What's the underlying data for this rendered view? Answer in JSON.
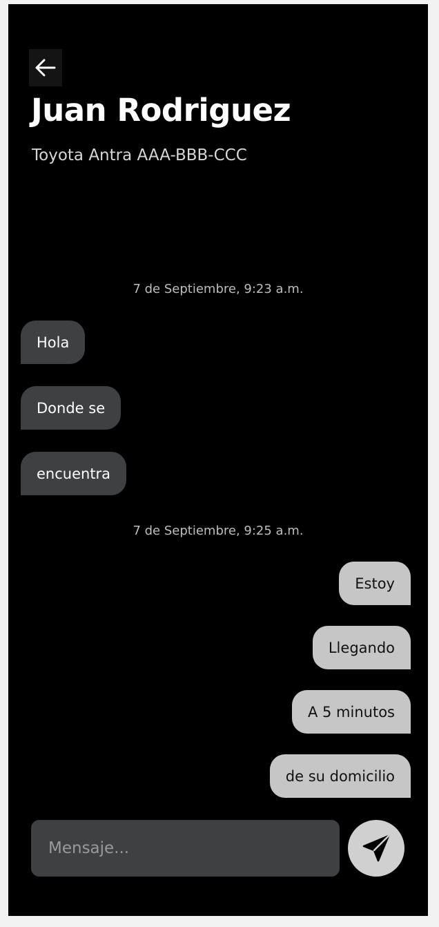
{
  "header": {
    "back_icon": "arrow-left-icon",
    "contact_name": "Juan Rodriguez",
    "vehicle": "Toyota Antra AAA-BBB-CCC"
  },
  "conversation": {
    "groups": [
      {
        "timestamp": "7 de Septiembre, 9:23 a.m.",
        "messages": [
          {
            "direction": "incoming",
            "text": "Hola"
          },
          {
            "direction": "incoming",
            "text": "Donde se"
          },
          {
            "direction": "incoming",
            "text": "encuentra"
          }
        ]
      },
      {
        "timestamp": "7 de Septiembre, 9:25 a.m.",
        "messages": [
          {
            "direction": "outgoing",
            "text": "Estoy"
          },
          {
            "direction": "outgoing",
            "text": "Llegando"
          },
          {
            "direction": "outgoing",
            "text": "A 5 minutos"
          },
          {
            "direction": "outgoing",
            "text": "de su domicilio"
          }
        ]
      }
    ]
  },
  "composer": {
    "placeholder": "Mensaje...",
    "value": "",
    "send_icon": "paper-plane-send-icon"
  },
  "colors": {
    "background": "#000000",
    "incoming_bubble": "#3f4042",
    "outgoing_bubble": "#c6c6c6",
    "input_background": "#3f4042",
    "send_button": "#d0d0d0"
  }
}
